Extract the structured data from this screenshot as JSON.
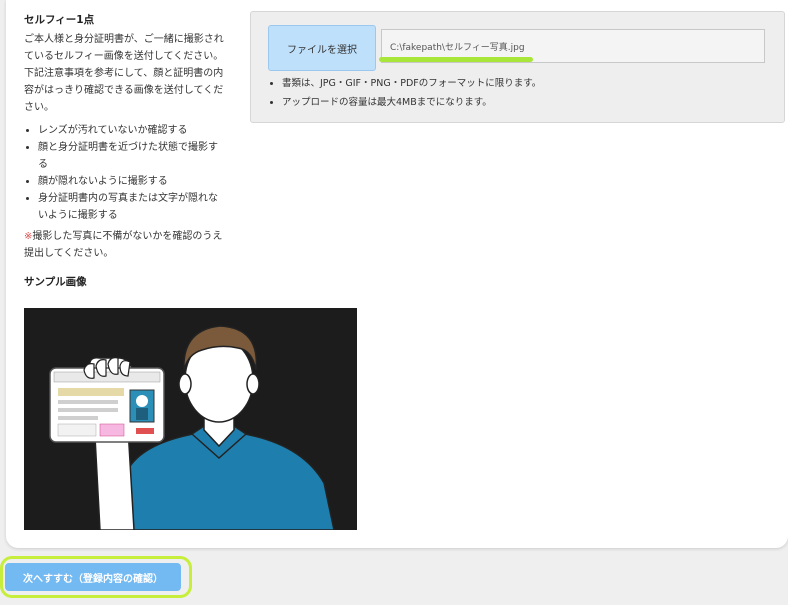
{
  "left": {
    "title": "セルフィー1点",
    "intro1": "ご本人様と身分証明書が、ご一緒に撮影されているセルフィー画像を送付してください。",
    "intro2": "下記注意事項を参考にして、顔と証明書の内容がはっきり確認できる画像を送付してください。",
    "checks": [
      "レンズが汚れていないか確認する",
      "顔と身分証明書を近づけた状態で撮影する",
      "顔が隠れないように撮影する",
      "身分証明書内の写真または文字が隠れないように撮影する"
    ],
    "note_mark": "※",
    "note_text": "撮影した写真に不備がないかを確認のうえ提出してください。",
    "sample_title": "サンプル画像"
  },
  "upload": {
    "button_label": "ファイルを選択",
    "file_path": "C:\\fakepath\\セルフィー写真.jpg",
    "info": [
      "書類は、JPG・GIF・PNG・PDFのフォーマットに限ります。",
      "アップロードの容量は最大4MBまでになります。"
    ]
  },
  "footer": {
    "next_label": "次へすすむ（登録内容の確認）"
  },
  "colors": {
    "accent_blue": "#73b9f2",
    "highlight_green": "#c6ee3a",
    "note_red": "#e05050"
  }
}
